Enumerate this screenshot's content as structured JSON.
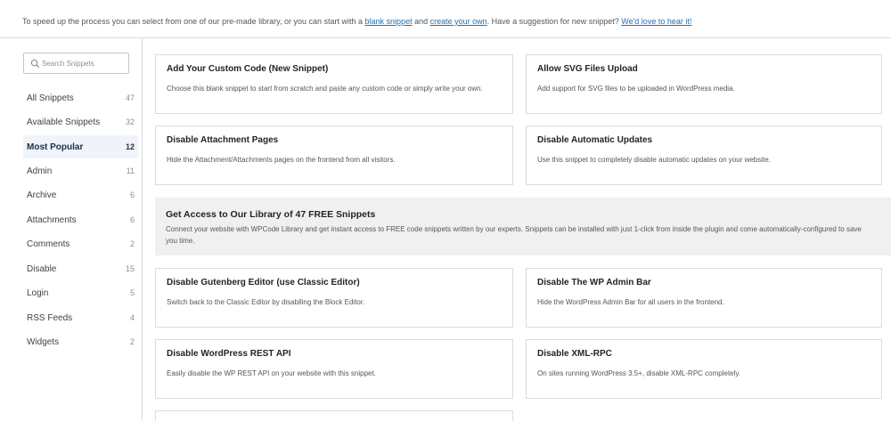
{
  "notice": {
    "prefix": "To speed up the process you can select from one of our pre-made library, or you can start with a ",
    "link_blank": "blank snippet",
    "middle": " and ",
    "link_create": "create your own",
    "after": ". Have a suggestion for new snippet? ",
    "link_suggest": "We'd love to hear it!"
  },
  "search": {
    "placeholder": "Search Snippets",
    "value": ""
  },
  "categories": [
    {
      "label": "All Snippets",
      "count": "47"
    },
    {
      "label": "Available Snippets",
      "count": "32"
    },
    {
      "label": "Most Popular",
      "count": "12"
    },
    {
      "label": "Admin",
      "count": "11"
    },
    {
      "label": "Archive",
      "count": "6"
    },
    {
      "label": "Attachments",
      "count": "6"
    },
    {
      "label": "Comments",
      "count": "2"
    },
    {
      "label": "Disable",
      "count": "15"
    },
    {
      "label": "Login",
      "count": "5"
    },
    {
      "label": "RSS Feeds",
      "count": "4"
    },
    {
      "label": "Widgets",
      "count": "2"
    }
  ],
  "active_category": "Most Popular",
  "cards": [
    {
      "title": "Add Your Custom Code (New Snippet)",
      "desc": "Choose this blank snippet to start from scratch and paste any custom code or simply write your own."
    },
    {
      "title": "Allow SVG Files Upload",
      "desc": "Add support for SVG files to be uploaded in WordPress media."
    },
    {
      "title": "Disable Attachment Pages",
      "desc": "Hide the Attachment/Attachments pages on the frontend from all visitors."
    },
    {
      "title": "Disable Automatic Updates",
      "desc": "Use this snippet to completely disable automatic updates on your website."
    },
    {
      "title": "Disable Gutenberg Editor (use Classic Editor)",
      "desc": "Switch back to the Classic Editor by disablling the Block Editor."
    },
    {
      "title": "Disable The WP Admin Bar",
      "desc": "Hide the WordPress Admin Bar for all users in the frontend."
    },
    {
      "title": "Disable WordPress REST API",
      "desc": "Easily disable the WP REST API on your website with this snippet."
    },
    {
      "title": "Disable XML-RPC",
      "desc": "On sites running WordPress 3.5+, disable XML-RPC completely."
    },
    {
      "title": "",
      "desc": ""
    }
  ],
  "promo": {
    "title": "Get Access to Our Library of 47 FREE Snippets",
    "desc": "Connect your website with WPCode Library and get instant access to FREE code snippets written by our experts. Snippets can be installed with just 1-click from inside the plugin and come automatically-configured to save you time."
  },
  "colors": {
    "link": "#2271b1",
    "active_bg": "#f0f4fa",
    "border": "#dcdcde",
    "promo_bg": "#f0f0f1"
  }
}
